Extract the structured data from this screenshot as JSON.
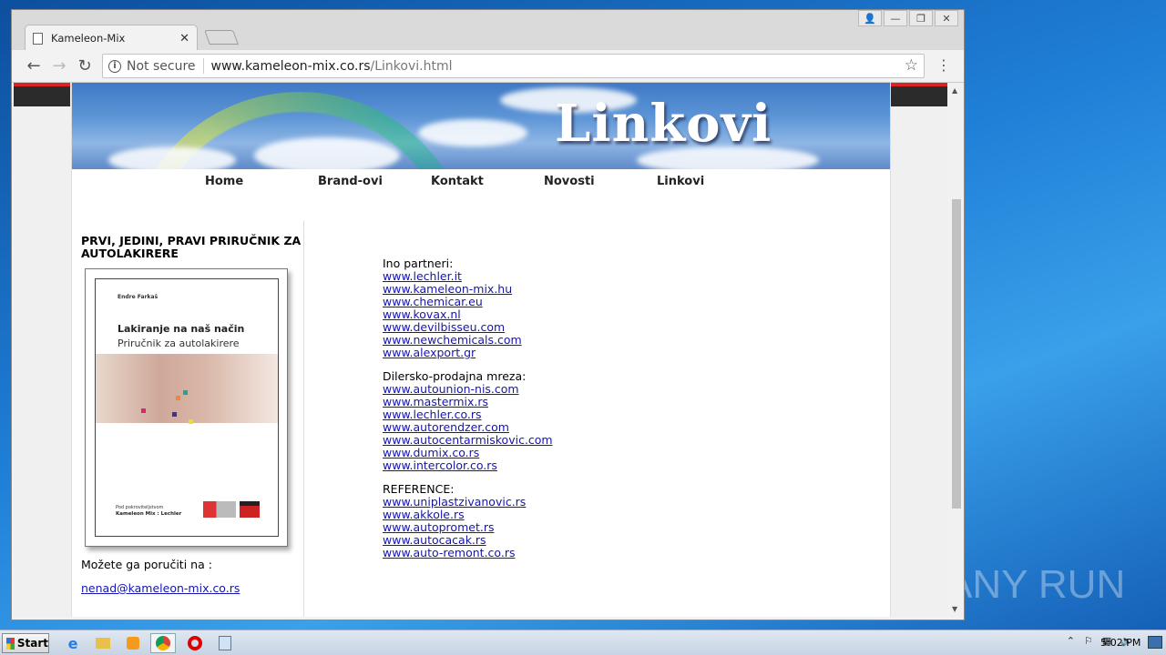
{
  "browser": {
    "tab_title": "Kameleon-Mix",
    "tab_close": "✕",
    "address_not_secure": "Not secure",
    "address_host": "www.kameleon-mix.co.rs",
    "address_path": "/Linkovi.html",
    "window_controls": [
      "👤",
      "—",
      "❐",
      "✕"
    ]
  },
  "page": {
    "banner_title": "Linkovi",
    "nav": [
      "Home",
      "Brand-ovi",
      "Kontakt",
      "Novosti",
      "Linkovi"
    ],
    "sidebar": {
      "heading": "PRVI, JEDINI, PRAVI PRIRUČNIK ZA AUTOLAKIRERE",
      "book": {
        "author": "Endre Farkaš",
        "title": "Lakiranje na naš način",
        "subtitle": "Priručnik za autolakirere",
        "footer_line1": "Pod pokroviteljstvom",
        "footer_line2": "Kameleon Mix : Lechler"
      },
      "order_text": "Možete ga poručiti na :",
      "order_email": "nenad@kameleon-mix.co.rs"
    },
    "groups": [
      {
        "heading": "Ino partneri:",
        "links": [
          "www.lechler.it",
          "www.kameleon-mix.hu",
          "www.chemicar.eu",
          "www.kovax.nl",
          "www.devilbisseu.com",
          "www.newchemicals.com",
          "www.alexport.gr"
        ]
      },
      {
        "heading": "Dilersko-prodajna mreza:",
        "links": [
          "www.autounion-nis.com",
          "www.mastermix.rs",
          "www.lechler.co.rs",
          "www.autorendzer.com",
          "www.autocentarmiskovic.com",
          "www.dumix.co.rs",
          "www.intercolor.co.rs"
        ]
      },
      {
        "heading": "REFERENCE:",
        "links": [
          "www.uniplastzivanovic.rs",
          "www.akkole.rs",
          "www.autopromet.rs",
          "www.autocacak.rs",
          "www.auto-remont.co.rs"
        ]
      }
    ]
  },
  "taskbar": {
    "start_label": "Start",
    "clock": "5:02 PM"
  },
  "watermark": "ANY RUN",
  "colors": {
    "link": "#1515b0",
    "accent_red": "#dd2222"
  }
}
